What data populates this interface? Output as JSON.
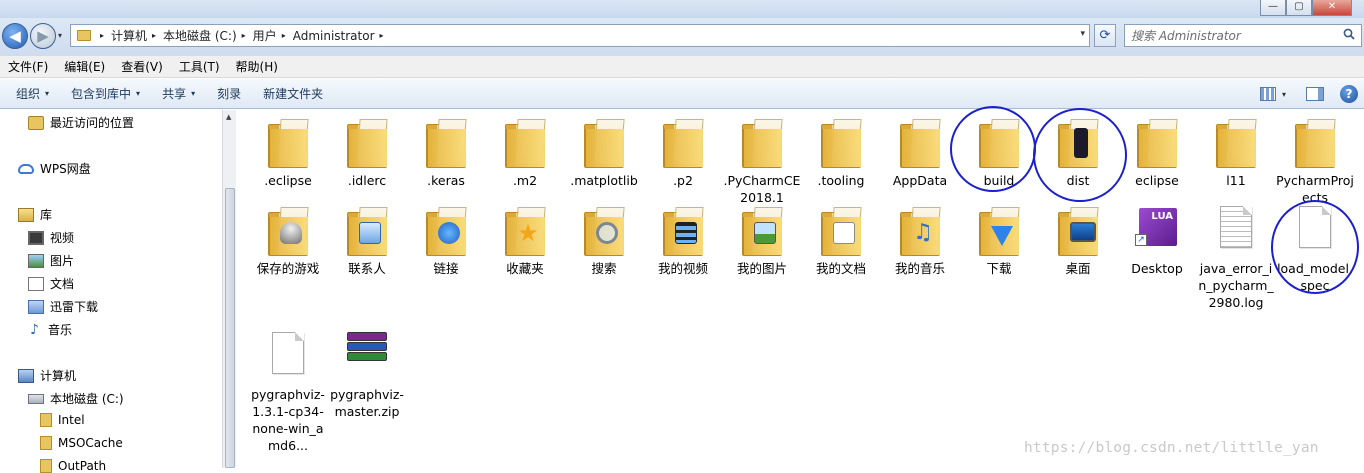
{
  "window": {
    "minimize_glyph": "—",
    "maximize_glyph": "▢",
    "close_glyph": "✕"
  },
  "address": {
    "crumbs": [
      "计算机",
      "本地磁盘 (C:)",
      "用户",
      "Administrator"
    ],
    "separator_glyph": "▸",
    "dropdown_glyph": "▾",
    "refresh_glyph": "⟳",
    "back_glyph": "◀",
    "forward_glyph": "▶"
  },
  "search": {
    "placeholder": "搜索 Administrator",
    "icon": "search-icon"
  },
  "menu": [
    "文件(F)",
    "编辑(E)",
    "查看(V)",
    "工具(T)",
    "帮助(H)"
  ],
  "toolbar": {
    "organize": "组织",
    "include_library": "包含到库中",
    "share": "共享",
    "burn": "刻录",
    "new_folder": "新建文件夹",
    "caret": "▾",
    "help": "?"
  },
  "sidebar": {
    "recent": "最近访问的位置",
    "wps": "WPS网盘",
    "library": "库",
    "lib_items": [
      "视频",
      "图片",
      "文档",
      "迅雷下载",
      "音乐"
    ],
    "computer": "计算机",
    "drive": "本地磁盘 (C:)",
    "drive_folders": [
      "Intel",
      "MSOCache",
      "OutPath"
    ]
  },
  "items_row1": [
    ".eclipse",
    ".idlerc",
    ".keras",
    ".m2",
    ".matplotlib",
    ".p2",
    ".PyCharmCE2018.1",
    ".tooling",
    "AppData",
    "build",
    "dist",
    "eclipse",
    "l11",
    "PycharmProjects"
  ],
  "items_row2": [
    "保存的游戏",
    "联系人",
    "链接",
    "收藏夹",
    "搜索",
    "我的视频",
    "我的图片",
    "我的文档",
    "我的音乐",
    "下载",
    "桌面",
    "Desktop",
    "java_error_in_pycharm_2980.log",
    "load_model.spec"
  ],
  "items_row3": [
    "pygraphviz-1.3.1-cp34-none-win_amd6...",
    "pygraphviz-master.zip"
  ],
  "lua_label": "LUA",
  "watermark": "https://blog.csdn.net/littlle_yan",
  "colors": {
    "annotation": "#1b1fcc",
    "folder": "#f6d873",
    "accent": "#1e5fc2"
  }
}
